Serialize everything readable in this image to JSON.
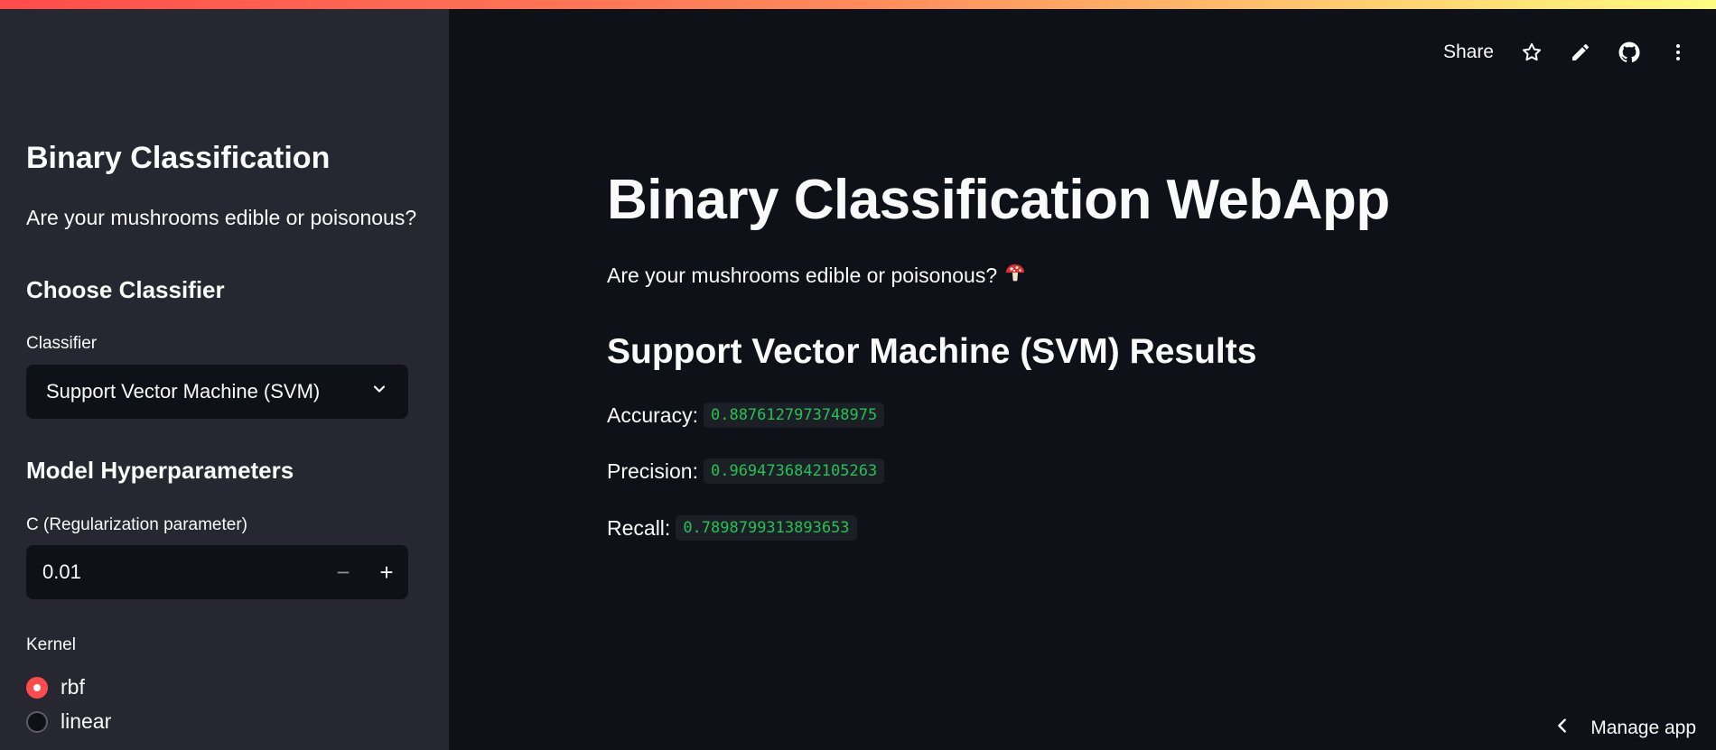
{
  "sidebar": {
    "title": "Binary Classification",
    "subtitle": "Are your mushrooms edible or poisonous?",
    "choose_heading": "Choose Classifier",
    "classifier_label": "Classifier",
    "classifier_value": "Support Vector Machine (SVM)",
    "hyper_heading": "Model Hyperparameters",
    "c_label": "C (Regularization parameter)",
    "c_value": "0.01",
    "kernel_label": "Kernel",
    "kernel_options": [
      "rbf",
      "linear"
    ],
    "kernel_selected": "rbf"
  },
  "toolbar": {
    "share_label": "Share",
    "icons": [
      "star-icon",
      "edit-icon",
      "github-icon",
      "more-vert-icon"
    ]
  },
  "main": {
    "title": "Binary Classification WebApp",
    "subtitle": "Are your mushrooms edible or poisonous?",
    "results_heading": "Support Vector Machine (SVM) Results",
    "metrics": [
      {
        "label": "Accuracy:",
        "value": "0.8876127973748975"
      },
      {
        "label": "Precision:",
        "value": "0.9694736842105263"
      },
      {
        "label": "Recall:",
        "value": "0.7898799313893653"
      }
    ]
  },
  "footer": {
    "manage_label": "Manage app"
  },
  "colors": {
    "accent": "#ff4b4b",
    "sidebar_bg": "#262730",
    "main_bg": "#0e1117",
    "code_green": "#21c354"
  }
}
